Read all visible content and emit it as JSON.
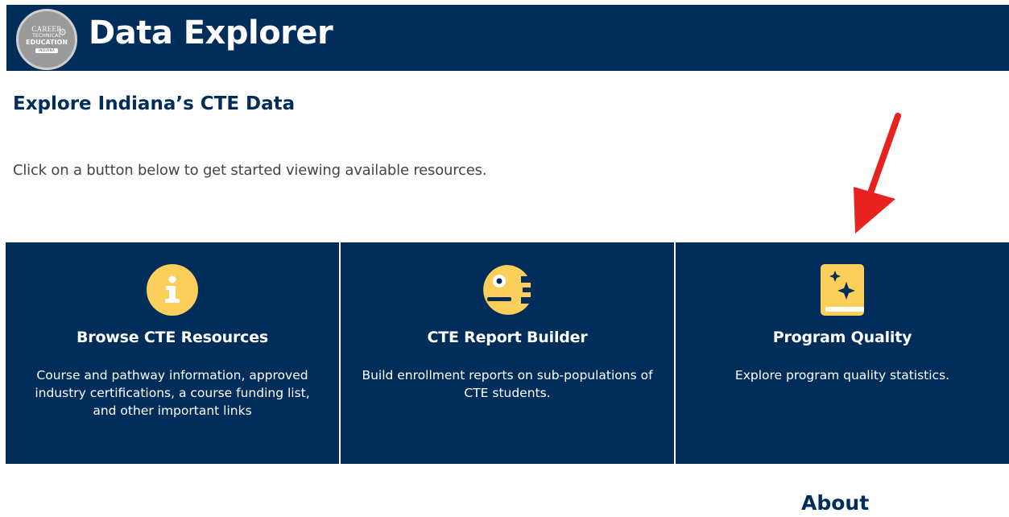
{
  "header": {
    "logo": {
      "line1": "CAREER",
      "line2": "TECHNICAL",
      "line3": "EDUCATION",
      "line4": "INDIANA"
    },
    "title": "Data Explorer"
  },
  "main": {
    "heading": "Explore Indiana’s CTE Data",
    "intro": "Click on a button below to get started viewing available resources.",
    "tiles": [
      {
        "icon": "info-circle-icon",
        "title": "Browse CTE Resources",
        "description": "Course and pathway information, approved industry certifications, a course funding list, and other important links"
      },
      {
        "icon": "report-builder-icon",
        "title": "CTE Report Builder",
        "description": "Build enrollment reports on sub-populations of CTE students."
      },
      {
        "icon": "sparkle-book-icon",
        "title": "Program Quality",
        "description": "Explore program quality statistics."
      }
    ],
    "about": "About"
  },
  "colors": {
    "navy": "#002D5A",
    "icon_yellow": "#FBCF5A",
    "annotation_red": "#E8231F"
  }
}
